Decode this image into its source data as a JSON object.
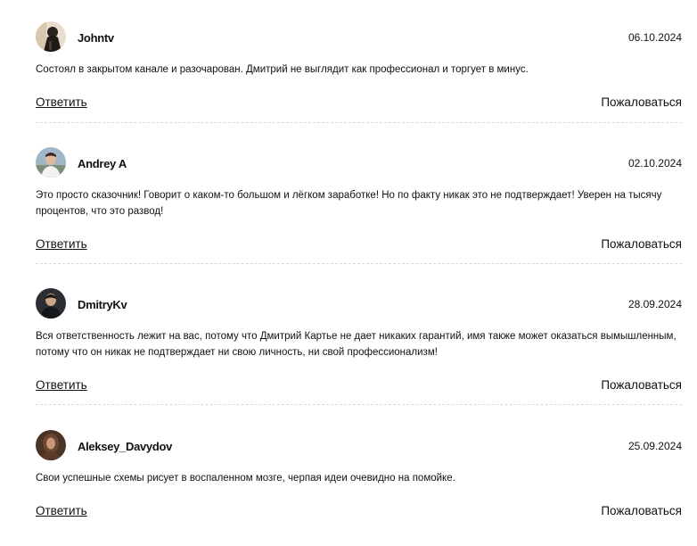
{
  "comments": [
    {
      "author": "Johntv",
      "date": "06.10.2024",
      "text": "Состоял в закрытом канале и разочарован. Дмитрий не выглядит как профессионал и торгует в минус.",
      "reply_label": "Ответить",
      "report_label": "Пожаловаться",
      "avatar": "avatar-dark-figure"
    },
    {
      "author": "Andrey A",
      "date": "02.10.2024",
      "text": "Это просто сказочник! Говорит о каком-то большом и лёгком заработке! Но по факту никак это не подтверждает! Уверен на тысячу процентов, что это развод!",
      "reply_label": "Ответить",
      "report_label": "Пожаловаться",
      "avatar": "avatar-man-outdoors"
    },
    {
      "author": "DmitryKv",
      "date": "28.09.2024",
      "text": "Вся ответственность лежит на вас, потому что Дмитрий Картье не дает никаких гарантий, имя также может оказаться вымышленным, потому что он никак не подтверждает ни свою личность, ни свой профессионализм!",
      "reply_label": "Ответить",
      "report_label": "Пожаловаться",
      "avatar": "avatar-man-dark"
    },
    {
      "author": "Aleksey_Davydov",
      "date": "25.09.2024",
      "text": "Свои успешные схемы рисует в воспаленном мозге, черпая идеи очевидно на помойке.",
      "reply_label": "Ответить",
      "report_label": "Пожаловаться",
      "avatar": "avatar-woman-brown"
    }
  ]
}
